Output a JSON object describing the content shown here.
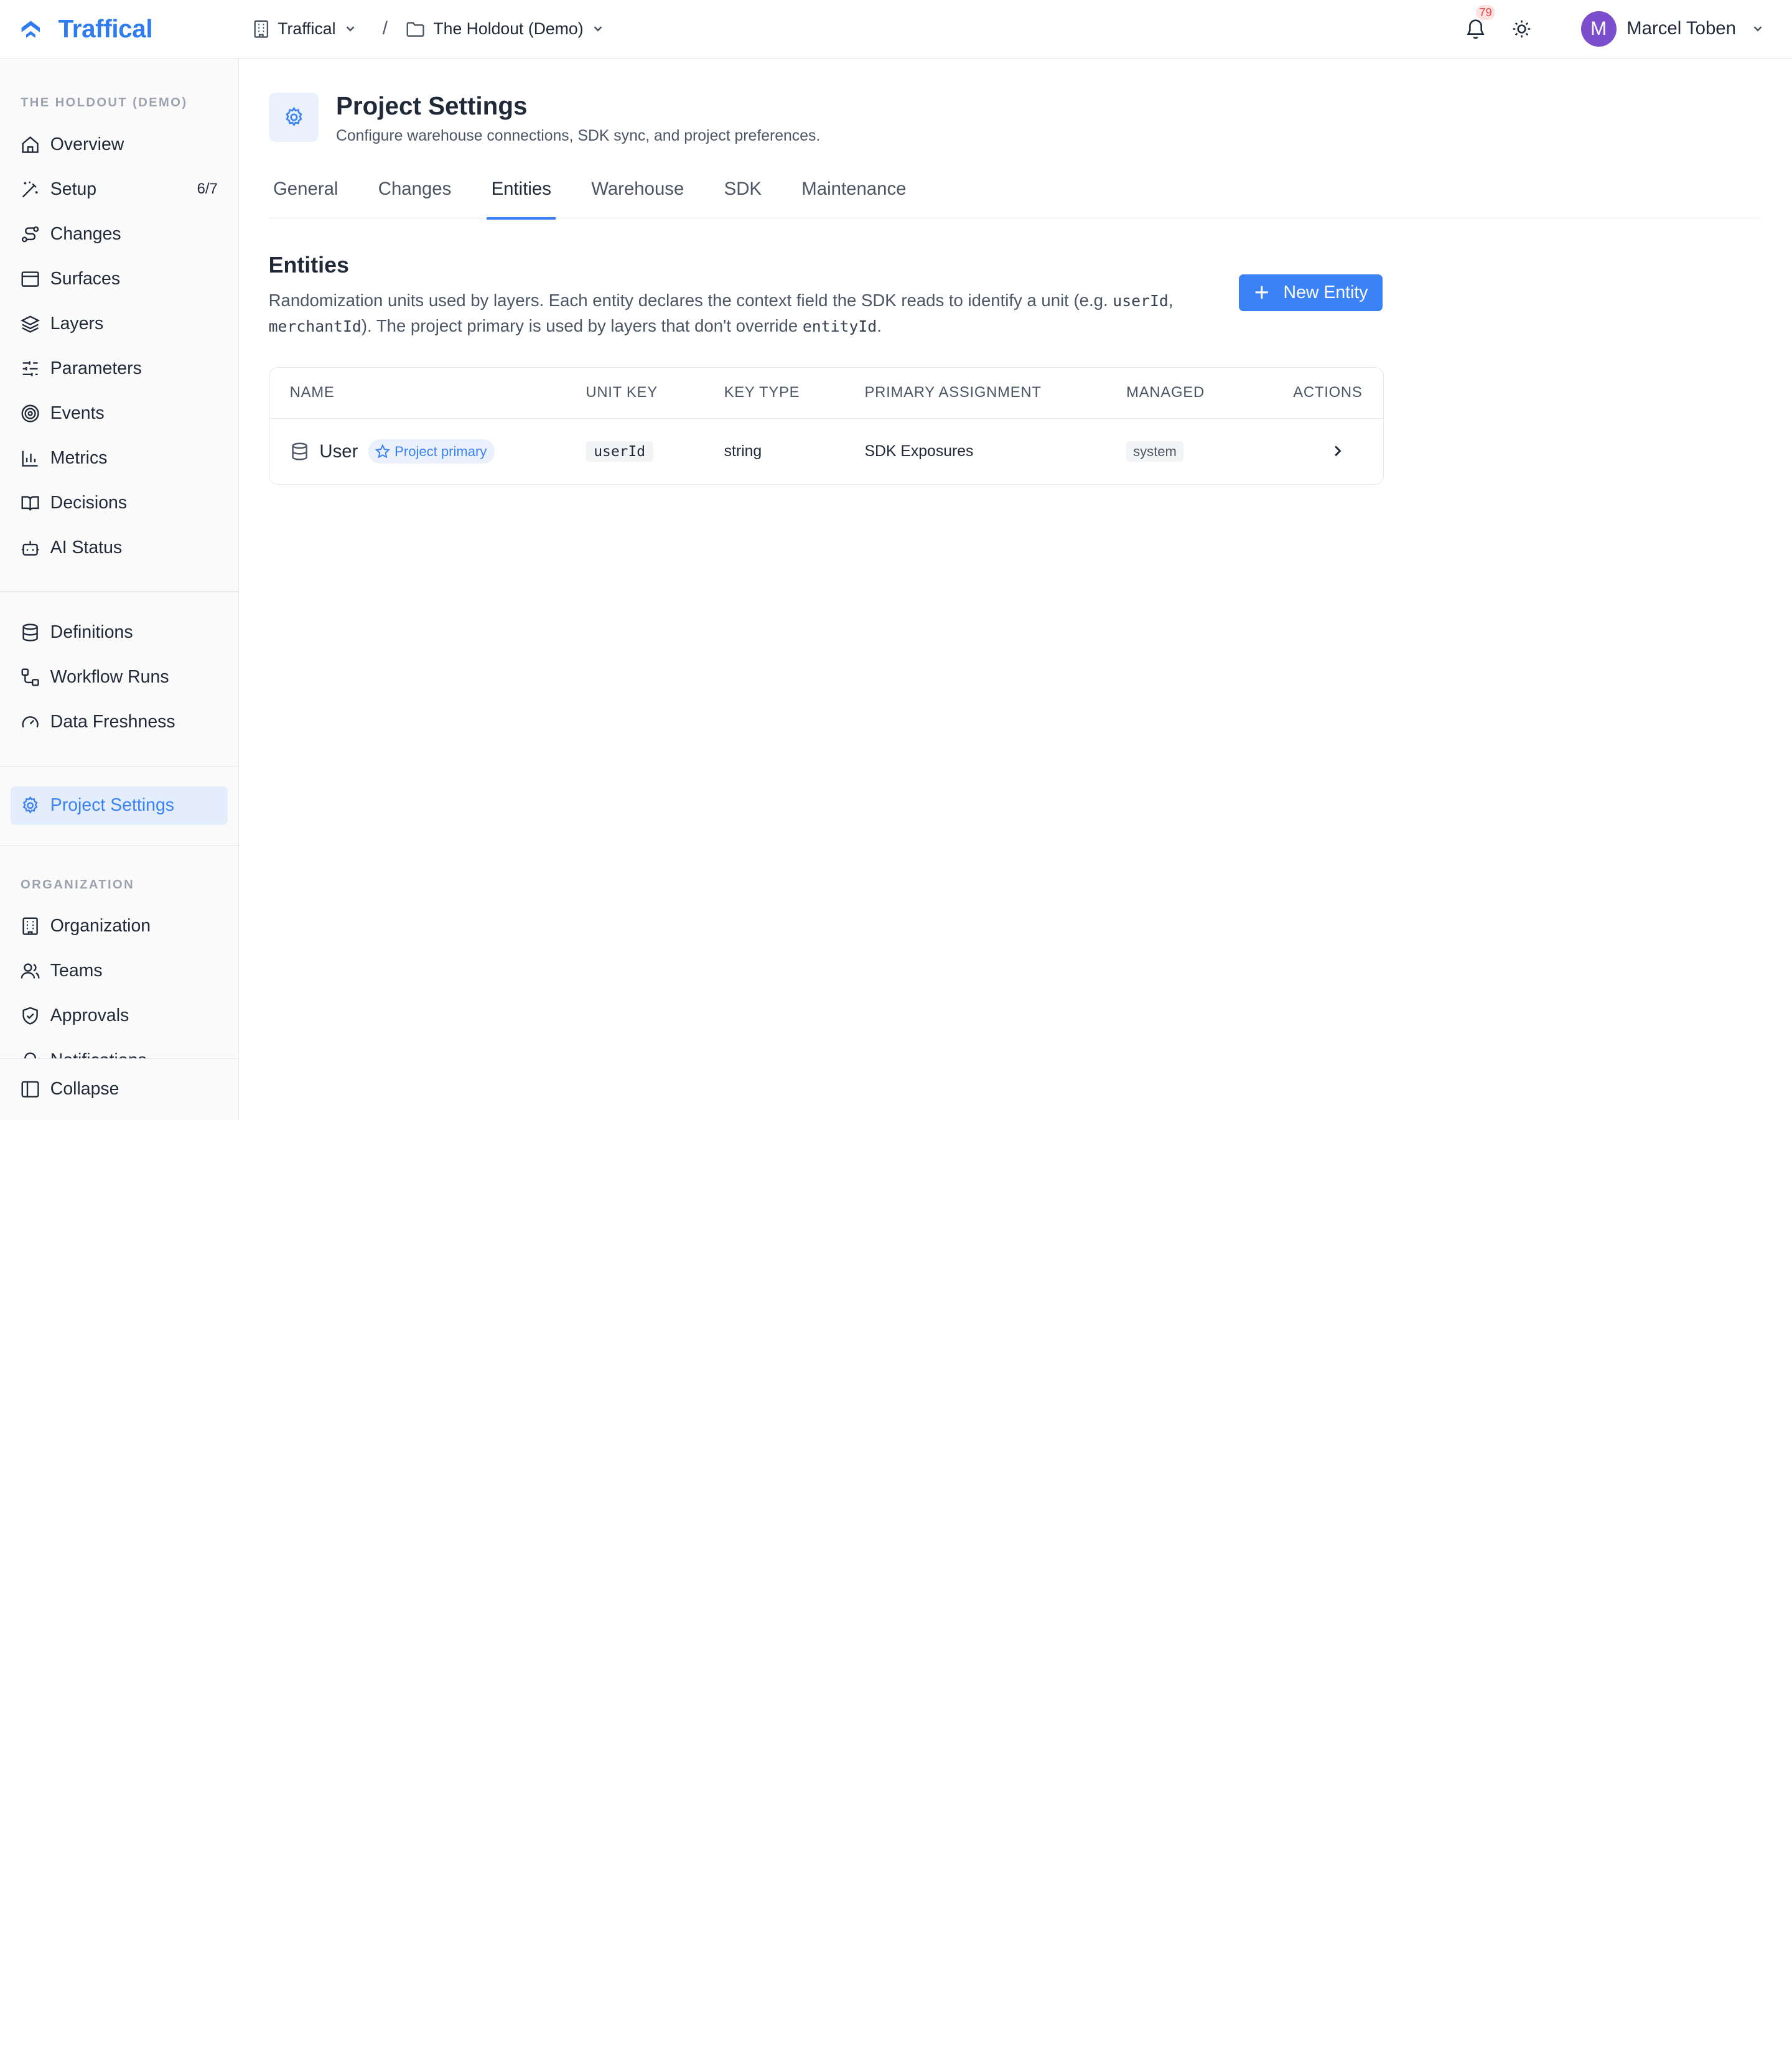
{
  "header": {
    "brand": "Traffical",
    "org": "Traffical",
    "separator": "/",
    "project": "The Holdout (Demo)",
    "notification_count": "79",
    "user_initial": "M",
    "user_name": "Marcel Toben"
  },
  "sidebar": {
    "project_section_label": "THE HOLDOUT (DEMO)",
    "project_items": [
      {
        "label": "Overview",
        "icon": "home-icon"
      },
      {
        "label": "Setup",
        "icon": "wand-icon",
        "count": "6/7"
      },
      {
        "label": "Changes",
        "icon": "route-icon"
      },
      {
        "label": "Surfaces",
        "icon": "window-icon"
      },
      {
        "label": "Layers",
        "icon": "layers-icon"
      },
      {
        "label": "Parameters",
        "icon": "sliders-icon"
      },
      {
        "label": "Events",
        "icon": "target-icon"
      },
      {
        "label": "Metrics",
        "icon": "bar-chart-icon"
      },
      {
        "label": "Decisions",
        "icon": "book-icon"
      },
      {
        "label": "AI Status",
        "icon": "bot-icon"
      }
    ],
    "data_items": [
      {
        "label": "Definitions",
        "icon": "database-icon"
      },
      {
        "label": "Workflow Runs",
        "icon": "workflow-icon"
      },
      {
        "label": "Data Freshness",
        "icon": "gauge-icon"
      }
    ],
    "settings_item": {
      "label": "Project Settings",
      "icon": "gear-icon"
    },
    "org_section_label": "ORGANIZATION",
    "org_items": [
      {
        "label": "Organization",
        "icon": "building-icon"
      },
      {
        "label": "Teams",
        "icon": "users-icon"
      },
      {
        "label": "Approvals",
        "icon": "shield-check-icon"
      },
      {
        "label": "Notifications",
        "icon": "bell-icon"
      }
    ],
    "collapse_label": "Collapse"
  },
  "page": {
    "title": "Project Settings",
    "subtitle": "Configure warehouse connections, SDK sync, and project preferences."
  },
  "tabs": [
    {
      "label": "General"
    },
    {
      "label": "Changes"
    },
    {
      "label": "Entities",
      "active": true
    },
    {
      "label": "Warehouse"
    },
    {
      "label": "SDK"
    },
    {
      "label": "Maintenance"
    }
  ],
  "entities": {
    "title": "Entities",
    "desc_1": "Randomization units used by layers. Each entity declares the context field the SDK reads to identify a unit (e.g. ",
    "code_1": "userId",
    "desc_2": ", ",
    "code_2": "merchantId",
    "desc_3": "). The project primary is used by layers that don't override ",
    "code_3": "entityId",
    "desc_4": ".",
    "new_button": "New Entity"
  },
  "table": {
    "columns": [
      "NAME",
      "UNIT KEY",
      "KEY TYPE",
      "PRIMARY ASSIGNMENT",
      "MANAGED",
      "ACTIONS"
    ],
    "rows": [
      {
        "name": "User",
        "badge": "Project primary",
        "unit_key": "userId",
        "key_type": "string",
        "primary_assignment": "SDK Exposures",
        "managed": "system"
      }
    ]
  },
  "colors": {
    "accent": "#3b82f6",
    "brand": "#2f7bf0",
    "avatar": "#7c4dcc",
    "badge_red": "#ef4444"
  }
}
